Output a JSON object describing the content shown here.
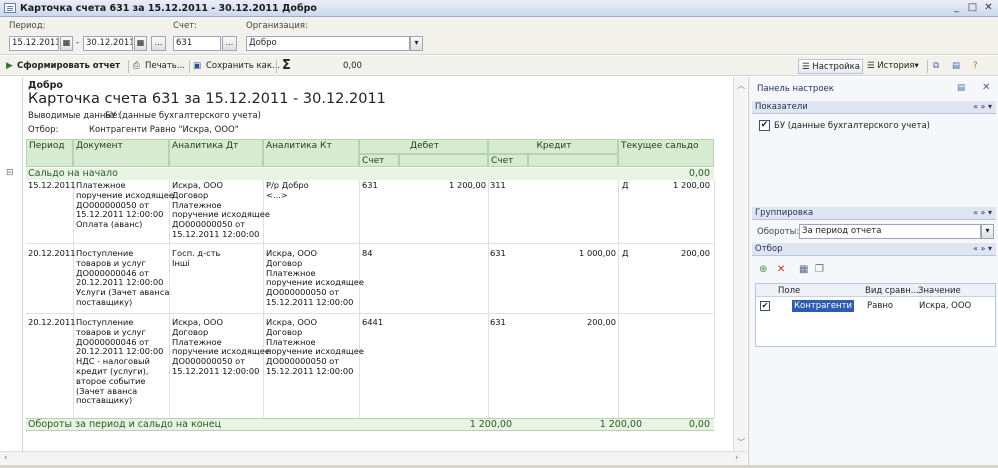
{
  "window": {
    "title": "Карточка счета 631 за 15.12.2011 - 30.12.2011 Добро",
    "min": "_",
    "max": "□",
    "close": "✕"
  },
  "filters": {
    "period_label": "Период:",
    "date_from": "15.12.2011",
    "dash": "-",
    "date_to": "30.12.2011",
    "dots": "...",
    "account_label": "Счет:",
    "account": "631",
    "org_label": "Организация:",
    "org": "Добро"
  },
  "toolbar": {
    "generate": "Сформировать отчет",
    "print": "Печать...",
    "save": "Сохранить как...",
    "sigma": "Σ",
    "sum": "0,00",
    "settings": "Настройка",
    "history": "История",
    "history_arrow": "▾"
  },
  "report": {
    "org": "Добро",
    "title": "Карточка счета 631 за 15.12.2011 - 30.12.2011",
    "data_label": "Выводимые данные:",
    "data_value": "БУ (данные бухгалтерского учета)",
    "filter_label": "Отбор:",
    "filter_value": "Контрагенти Равно \"Искра, ООО\"",
    "columns": {
      "period": "Период",
      "document": "Документ",
      "an_dt": "Аналитика Дт",
      "an_kt": "Аналитика Кт",
      "debit": "Дебет",
      "credit": "Кредит",
      "balance": "Текущее сальдо",
      "account": "Счет"
    },
    "opening_label": "Сальдо на начало",
    "opening_value": "0,00",
    "minus": "⊟",
    "rows": [
      {
        "period": "15.12.2011",
        "document": "Платежное\nпоручение исходящее\nДО000000050 от\n15.12.2011 12:00:00\nОплата (аванс)",
        "an_dt": "Искра, ООО\nДоговор\nПлатежное\nпоручение исходящее\nДО000000050 от\n15.12.2011 12:00:00",
        "an_kt": "Р/р Добро\n<...>",
        "dt_acc": "631",
        "dt_sum": "1 200,00",
        "kt_acc": "311",
        "kt_sum": "",
        "bal_side": "Д",
        "bal": "1 200,00"
      },
      {
        "period": "20.12.2011",
        "document": "Поступление\nтоваров и услуг\nДО000000046 от\n20.12.2011 12:00:00\nУслуги (Зачет аванса\nпоставщику)",
        "an_dt": "Госп. д-сть\nІнші",
        "an_kt": "Искра, ООО\nДоговор\nПлатежное\nпоручение исходящее\nДО000000050 от\n15.12.2011 12:00:00",
        "dt_acc": "84",
        "dt_sum": "",
        "kt_acc": "631",
        "kt_sum": "1 000,00",
        "bal_side": "Д",
        "bal": "200,00"
      },
      {
        "period": "20.12.2011",
        "document": "Поступление\nтоваров и услуг\nДО000000046 от\n20.12.2011 12:00:00\nНДС - налоговый\nкредит (услуги),\nвторое событие\n(Зачет аванса\nпоставщику)",
        "an_dt": "Искра, ООО\nДоговор\nПлатежное\nпоручение исходящее\nДО000000050 от\n15.12.2011 12:00:00",
        "an_kt": "Искра, ООО\nДоговор\nПлатежное\nпоручение исходящее\nДО000000050 от\n15.12.2011 12:00:00",
        "dt_acc": "6441",
        "dt_sum": "",
        "kt_acc": "631",
        "kt_sum": "200,00",
        "bal_side": "",
        "bal": ""
      }
    ],
    "totals_label": "Обороты за период и сальдо на конец",
    "totals_debit": "1 200,00",
    "totals_credit": "1 200,00",
    "totals_balance": "0,00"
  },
  "panel": {
    "title": "Панель настроек",
    "close": "✕",
    "indicators": "Показатели",
    "indicator_item": "БУ (данные бухгалтерского учета)",
    "grouping": "Группировка",
    "turnovers_label": "Обороты:",
    "turnovers_value": "За период отчета",
    "selection": "Отбор",
    "col_field": "Поле",
    "col_kind": "Вид сравн...",
    "col_value": "Значение",
    "f_field": "Контрагенти",
    "f_kind": "Равно",
    "f_value": "Искра, ООО",
    "nav": "« » ▾"
  },
  "colors": {
    "accent": "#3b8a3b",
    "header_bg": "#d7ebd2",
    "band_bg": "#e7f3e3",
    "panel_head": "#dfe6f2"
  }
}
